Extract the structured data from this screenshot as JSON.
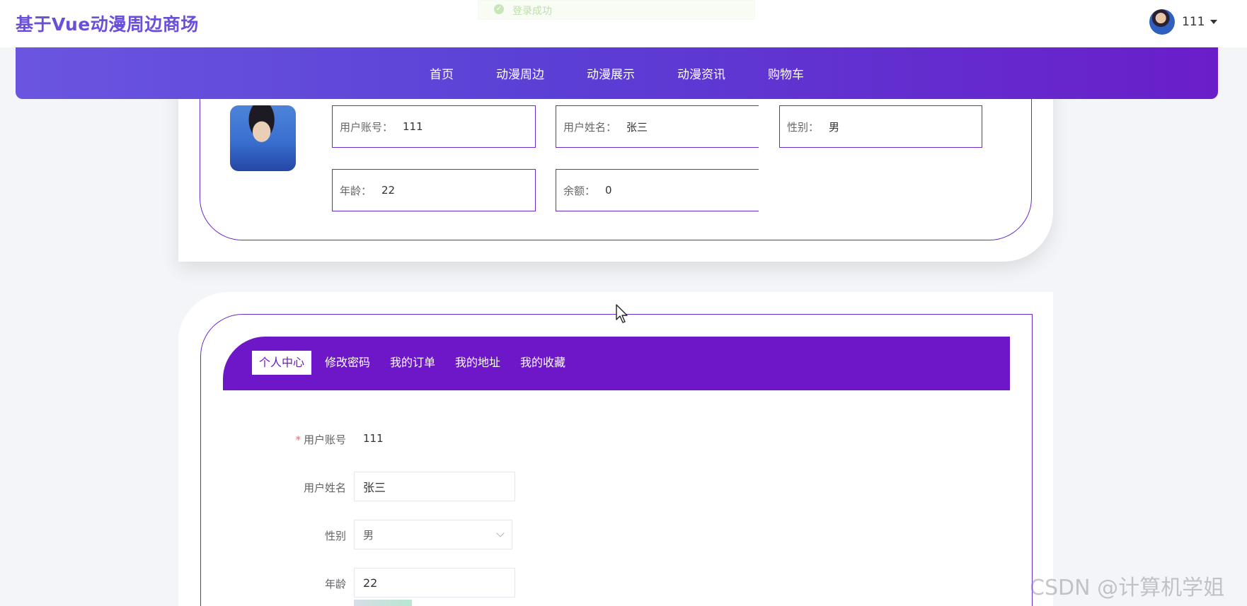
{
  "header": {
    "site_title": "基于Vue动漫周边商场",
    "toast_text": "登录成功",
    "user_name": "111"
  },
  "nav": {
    "items": [
      "首页",
      "动漫周边",
      "动漫展示",
      "动漫资讯",
      "购物车"
    ]
  },
  "profile": {
    "account_label": "用户账号：",
    "account_value": "111",
    "name_label": "用户姓名：",
    "name_value": "张三",
    "gender_label": "性别：",
    "gender_value": "男",
    "age_label": "年龄：",
    "age_value": "22",
    "balance_label": "余额：",
    "balance_value": "0"
  },
  "tabs": [
    "个人中心",
    "修改密码",
    "我的订单",
    "我的地址",
    "我的收藏"
  ],
  "active_tab": "个人中心",
  "form": {
    "account_label": "用户账号",
    "account_value": "111",
    "name_label": "用户姓名",
    "name_value": "张三",
    "gender_label": "性别",
    "gender_value": "男",
    "age_label": "年龄",
    "age_value": "22"
  },
  "watermark": "CSDN @计算机学姐",
  "colors": {
    "brand": "#6a4fd9",
    "tabbar": "#6d17c9",
    "border": "#6a2bc9",
    "required": "#f56c6c"
  }
}
